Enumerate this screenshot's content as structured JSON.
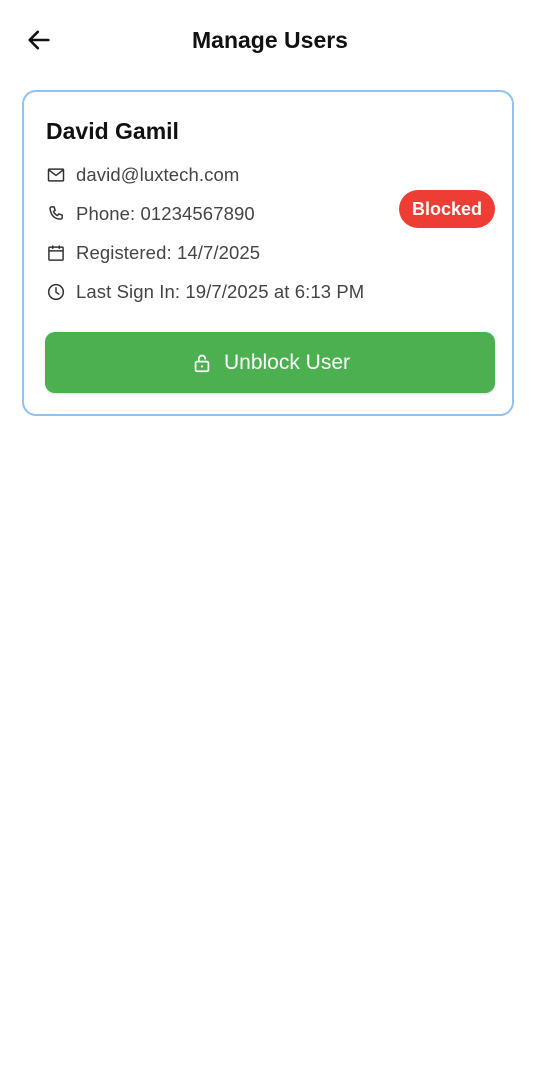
{
  "header": {
    "back_icon": "arrow-left-icon",
    "title": "Manage Users"
  },
  "user": {
    "name": "David Gamil",
    "email": "david@luxtech.com",
    "email_icon": "mail-icon",
    "phone": "Phone: 01234567890",
    "phone_icon": "phone-icon",
    "registered": "Registered: 14/7/2025",
    "registered_icon": "calendar-icon",
    "last_sign_in": "Last Sign In: 19/7/2025 at 6:13 PM",
    "last_sign_in_icon": "clock-icon",
    "status": "Blocked",
    "action_label": "Unblock User",
    "action_icon": "unlock-icon"
  },
  "colors": {
    "card_border": "#90c2ef",
    "status_badge": "#ee3d34",
    "action_button": "#4caf50",
    "secondary_text": "#444444"
  }
}
